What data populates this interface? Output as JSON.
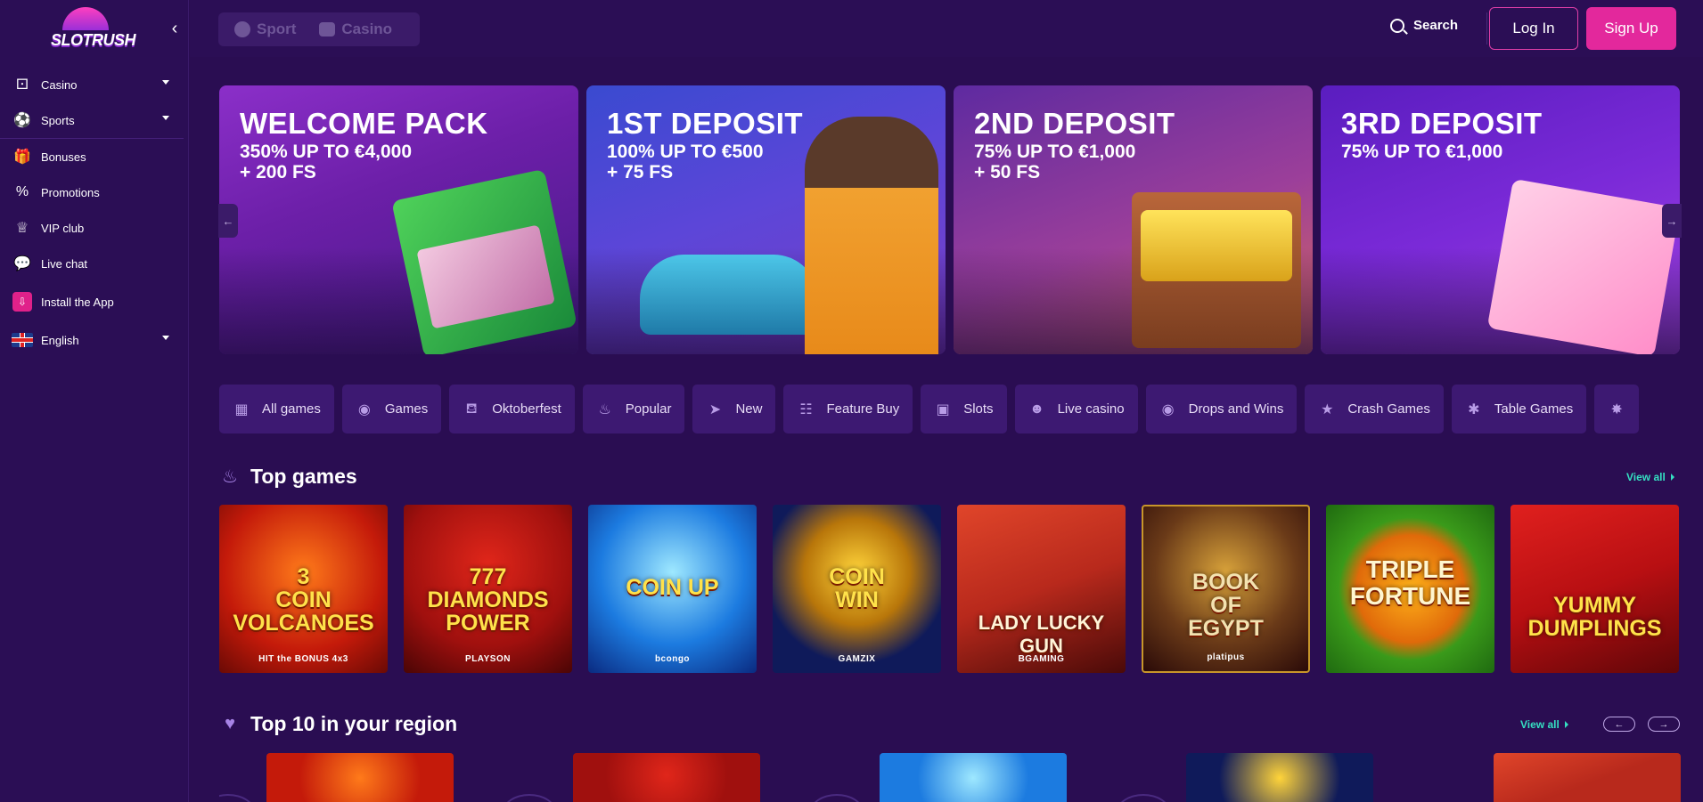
{
  "brand": {
    "name": "SLOTRUSH"
  },
  "sidebar": {
    "items": [
      {
        "label": "Casino",
        "icon": "dice-icon",
        "has_caret": true
      },
      {
        "label": "Sports",
        "icon": "ball-icon",
        "has_caret": true
      },
      {
        "label": "Bonuses",
        "icon": "gift-icon",
        "has_caret": false
      },
      {
        "label": "Promotions",
        "icon": "promo-icon",
        "has_caret": false
      },
      {
        "label": "VIP club",
        "icon": "crown-icon",
        "has_caret": false
      },
      {
        "label": "Live chat",
        "icon": "chat-icon",
        "has_caret": false
      },
      {
        "label": "Install the App",
        "icon": "install-icon",
        "has_caret": false
      },
      {
        "label": "English",
        "icon": "uk-flag-icon",
        "has_caret": true
      }
    ]
  },
  "header": {
    "tabs": [
      {
        "label": "Sport",
        "icon": "ball-icon"
      },
      {
        "label": "Casino",
        "icon": "dice-icon"
      }
    ],
    "search_label": "Search",
    "login_label": "Log In",
    "signup_label": "Sign Up"
  },
  "banners": [
    {
      "title": "WELCOME PACK",
      "subtitle": "350% UP TO €4,000\n+ 200 FS"
    },
    {
      "title": "1ST DEPOSIT",
      "subtitle": "100% UP TO €500\n+ 75 FS"
    },
    {
      "title": "2ND DEPOSIT",
      "subtitle": "75% UP TO €1,000\n+ 50 FS"
    },
    {
      "title": "3RD DEPOSIT",
      "subtitle": "75% UP TO €1,000"
    }
  ],
  "categories": [
    {
      "label": "All games",
      "icon": "grid-icon"
    },
    {
      "label": "Games",
      "icon": "games-icon"
    },
    {
      "label": "Oktoberfest",
      "icon": "beer-icon"
    },
    {
      "label": "Popular",
      "icon": "flame-icon"
    },
    {
      "label": "New",
      "icon": "rocket-icon"
    },
    {
      "label": "Feature Buy",
      "icon": "gamepad-icon"
    },
    {
      "label": "Slots",
      "icon": "slot-machine-icon"
    },
    {
      "label": "Live casino",
      "icon": "live-dealer-icon"
    },
    {
      "label": "Drops and Wins",
      "icon": "drops-icon"
    },
    {
      "label": "Crash Games",
      "icon": "star-icon"
    },
    {
      "label": "Table Games",
      "icon": "puzzle-icon"
    },
    {
      "label": "",
      "icon": "roulette-icon"
    }
  ],
  "top_games": {
    "title": "Top games",
    "view_all": "View all",
    "games": [
      {
        "title": "3\nCOIN\nVOLCANOES",
        "provider": "HIT the BONUS 4x3",
        "bg": "#c41a0a"
      },
      {
        "title": "777\nDIAMONDS\nPOWER",
        "provider": "PLAYSON",
        "bg": "#a0100e"
      },
      {
        "title": "COIN UP",
        "provider": "bcongo",
        "bg": "#1c7be0"
      },
      {
        "title": "COIN\nWIN",
        "provider": "GAMZIX",
        "bg": "#0f1a5a"
      },
      {
        "title": "LADY LUCKY\nGUN",
        "provider": "BGAMING",
        "bg": "#b8291c"
      },
      {
        "title": "BOOK\nOF\nEGYPT",
        "provider": "platipus",
        "bg": "#3a1a10"
      },
      {
        "title": "TRIPLE\nFORTUNE",
        "provider": "",
        "bg": "#3a9a1a"
      },
      {
        "title": "YUMMY\nDUMPLINGS",
        "provider": "",
        "bg": "#b80f12"
      }
    ]
  },
  "region": {
    "title": "Top 10 in your region",
    "view_all": "View all",
    "prev": "←",
    "next": "→"
  },
  "colors": {
    "background": "#2a0d52",
    "accent_pink": "#e3289c",
    "accent_teal": "#35e0c2"
  }
}
